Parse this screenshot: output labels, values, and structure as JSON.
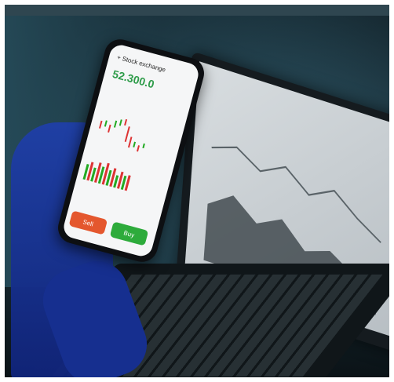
{
  "phone": {
    "title": "+ Stock exchange",
    "price": "52.300.0",
    "sell_label": "Sell",
    "buy_label": "Buy"
  },
  "colors": {
    "sell": "#e4572e",
    "buy": "#2dab3b",
    "price": "#2e9c4a"
  }
}
